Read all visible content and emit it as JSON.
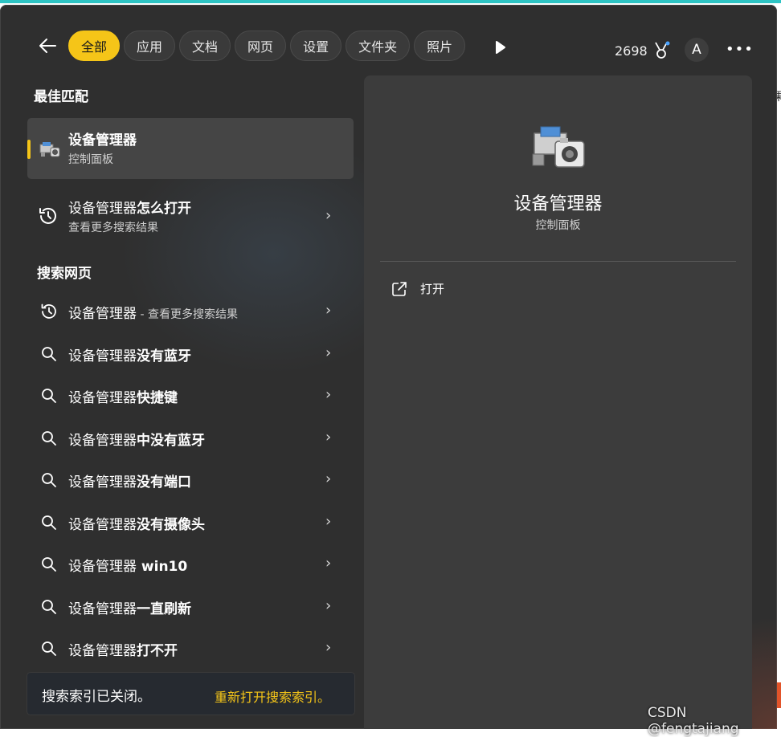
{
  "nav": {
    "tabs": [
      {
        "label": "全部",
        "active": true
      },
      {
        "label": "应用",
        "active": false
      },
      {
        "label": "文档",
        "active": false
      },
      {
        "label": "网页",
        "active": false
      },
      {
        "label": "设置",
        "active": false
      },
      {
        "label": "文件夹",
        "active": false
      },
      {
        "label": "照片",
        "active": false
      }
    ],
    "points": "2698",
    "avatar_letter": "A",
    "more": "•••"
  },
  "best_match": {
    "section_label": "最佳匹配",
    "title": "设备管理器",
    "subtitle": "控制面板"
  },
  "how_to_open": {
    "prefix": "设备管理器",
    "bold": "怎么打开",
    "subtitle": "查看更多搜索结果"
  },
  "web_search": {
    "section_label": "搜索网页",
    "items": [
      {
        "prefix": "设备管理器",
        "bold": "",
        "hint": " - 查看更多搜索结果",
        "icon": "history-icon"
      },
      {
        "prefix": "设备管理器",
        "bold": "没有蓝牙",
        "hint": "",
        "icon": "search-icon"
      },
      {
        "prefix": "设备管理器",
        "bold": "快捷键",
        "hint": "",
        "icon": "search-icon"
      },
      {
        "prefix": "设备管理器",
        "bold": "中没有蓝牙",
        "hint": "",
        "icon": "search-icon"
      },
      {
        "prefix": "设备管理器",
        "bold": "没有端口",
        "hint": "",
        "icon": "search-icon"
      },
      {
        "prefix": "设备管理器",
        "bold": "没有摄像头",
        "hint": "",
        "icon": "search-icon"
      },
      {
        "prefix": "设备管理器",
        "bold": " win10",
        "hint": "",
        "icon": "search-icon"
      },
      {
        "prefix": "设备管理器",
        "bold": "一直刷新",
        "hint": "",
        "icon": "search-icon"
      },
      {
        "prefix": "设备管理器",
        "bold": "打不开",
        "hint": "",
        "icon": "search-icon"
      }
    ]
  },
  "footer": {
    "message": "搜索索引已关闭。",
    "link": "重新打开搜索索引。"
  },
  "detail": {
    "title": "设备管理器",
    "subtitle": "控制面板",
    "action_open": "打开"
  },
  "watermark": "CSDN @fengtajiang",
  "edge_char": "果",
  "colors": {
    "accent": "#f5c518",
    "background": "#2f2f2f",
    "panel": "#3c3c3c"
  }
}
